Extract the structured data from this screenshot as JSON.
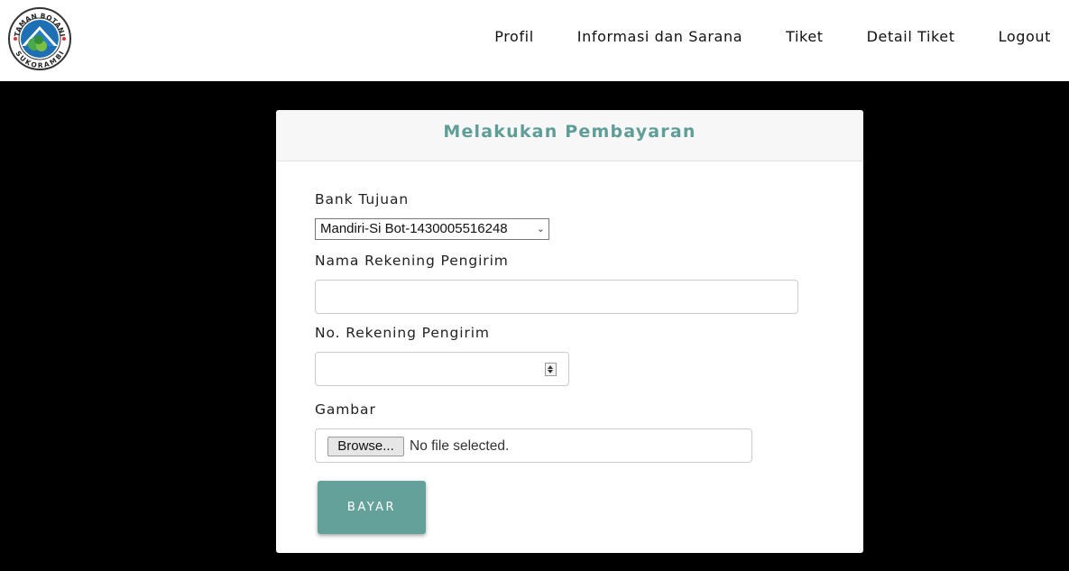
{
  "nav": {
    "logo_text_top": "TAMAN BOTANI",
    "logo_text_bottom": "SUKORAMBI",
    "links": [
      "Profil",
      "Informasi dan Sarana",
      "Tiket",
      "Detail Tiket",
      "Logout"
    ]
  },
  "form": {
    "title": "Melakukan Pembayaran",
    "bank_label": "Bank Tujuan",
    "bank_selected": "Mandiri-Si Bot-1430005516248",
    "name_label": "Nama Rekening Pengirim",
    "name_value": "",
    "account_label": "No. Rekening Pengirim",
    "account_value": "",
    "image_label": "Gambar",
    "browse_label": "Browse...",
    "file_status": "No file selected.",
    "submit_label": "BAYAR"
  },
  "colors": {
    "accent": "#65a19b",
    "title": "#5f9e98",
    "background": "#000000"
  }
}
